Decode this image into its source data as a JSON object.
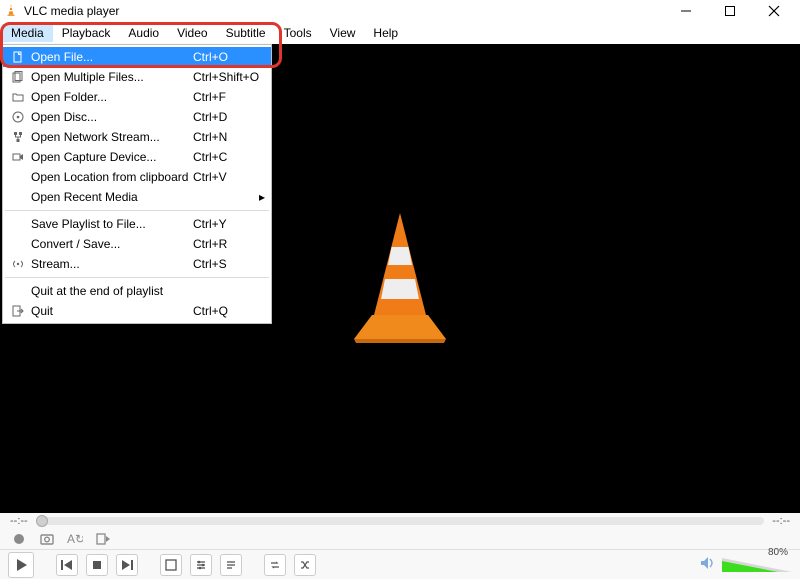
{
  "title": "VLC media player",
  "menubar": [
    "Media",
    "Playback",
    "Audio",
    "Video",
    "Subtitle",
    "Tools",
    "View",
    "Help"
  ],
  "menu_open_index": 0,
  "dropdown": {
    "groups": [
      [
        {
          "icon": "file",
          "label": "Open File...",
          "shortcut": "Ctrl+O",
          "hl": true
        },
        {
          "icon": "files",
          "label": "Open Multiple Files...",
          "shortcut": "Ctrl+Shift+O"
        },
        {
          "icon": "folder",
          "label": "Open Folder...",
          "shortcut": "Ctrl+F"
        },
        {
          "icon": "disc",
          "label": "Open Disc...",
          "shortcut": "Ctrl+D"
        },
        {
          "icon": "net",
          "label": "Open Network Stream...",
          "shortcut": "Ctrl+N"
        },
        {
          "icon": "cap",
          "label": "Open Capture Device...",
          "shortcut": "Ctrl+C"
        },
        {
          "icon": "",
          "label": "Open Location from clipboard",
          "shortcut": "Ctrl+V"
        },
        {
          "icon": "",
          "label": "Open Recent Media",
          "shortcut": "",
          "submenu": true
        }
      ],
      [
        {
          "icon": "",
          "label": "Save Playlist to File...",
          "shortcut": "Ctrl+Y"
        },
        {
          "icon": "",
          "label": "Convert / Save...",
          "shortcut": "Ctrl+R"
        },
        {
          "icon": "stream",
          "label": "Stream...",
          "shortcut": "Ctrl+S"
        }
      ],
      [
        {
          "icon": "",
          "label": "Quit at the end of playlist",
          "shortcut": ""
        },
        {
          "icon": "quit",
          "label": "Quit",
          "shortcut": "Ctrl+Q"
        }
      ]
    ]
  },
  "seek": {
    "left": "--:--",
    "right": "--:--"
  },
  "volume": {
    "percent_label": "80%"
  }
}
